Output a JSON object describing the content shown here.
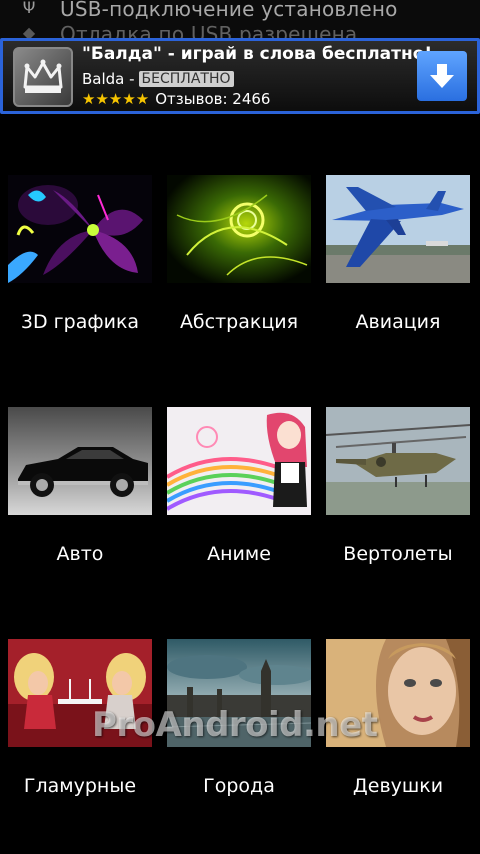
{
  "notification": {
    "line1": "USB-подключение установлено",
    "line2": "Отладка по USB разрешена"
  },
  "ad": {
    "title": "\"Балда\" - играй в слова бесплатно!",
    "app_name": "Balda -",
    "badge": "БЕСПЛАТНО",
    "stars": "★★★★★",
    "reviews": "Отзывов: 2466",
    "border_color": "#2b63d9"
  },
  "categories": [
    {
      "label": "3D графика"
    },
    {
      "label": "Абстракция"
    },
    {
      "label": "Авиация"
    },
    {
      "label": "Авто"
    },
    {
      "label": "Аниме"
    },
    {
      "label": "Вертолеты"
    },
    {
      "label": "Гламурные"
    },
    {
      "label": "Города"
    },
    {
      "label": "Девушки"
    }
  ],
  "watermark": "ProAndroid.net"
}
